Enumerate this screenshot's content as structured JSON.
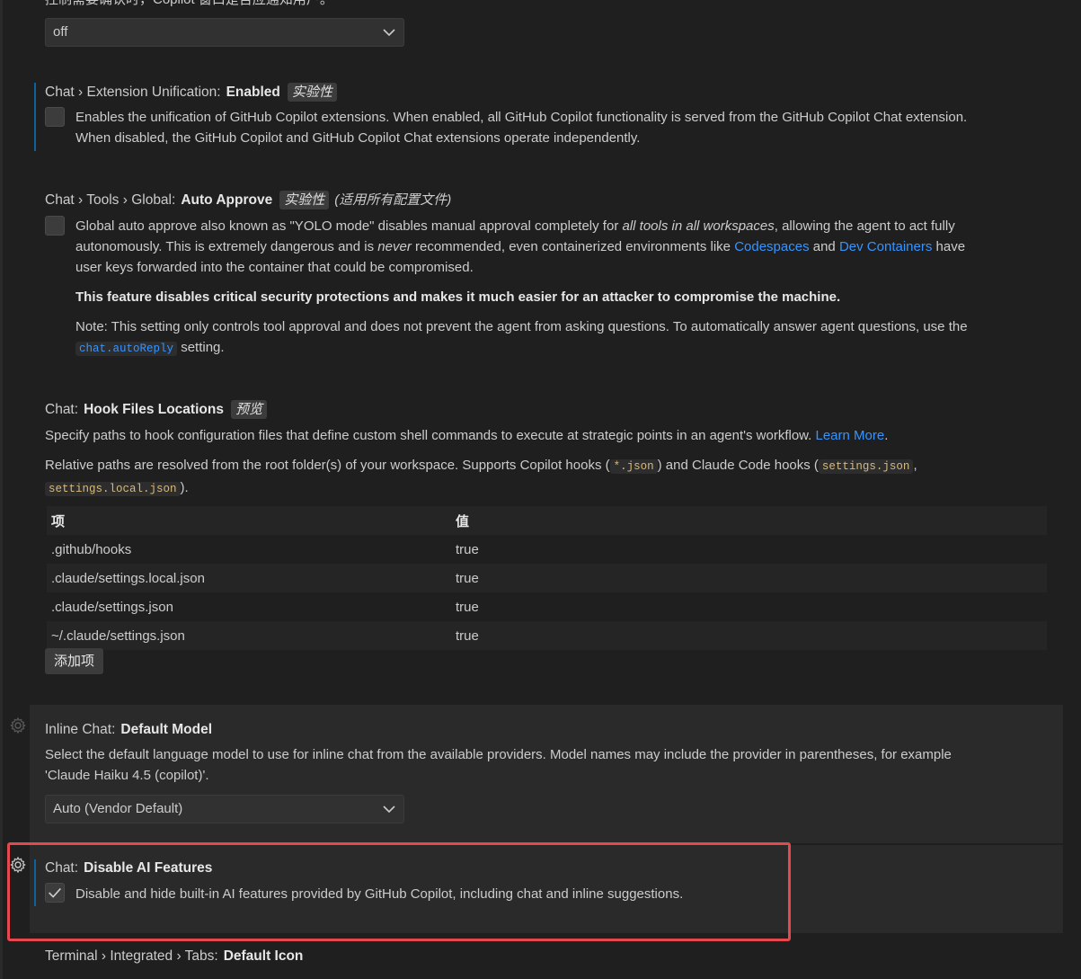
{
  "top_setting": {
    "partial_text": "控制需要确认时，Copilot 窗口是否应通知用户。",
    "select_value": "off"
  },
  "extension_unification": {
    "category": "Chat › Extension Unification:",
    "name": "Enabled",
    "tag": "实验性",
    "description_line1": "Enables the unification of GitHub Copilot extensions. When enabled, all GitHub Copilot functionality is served from the GitHub Copilot Chat extension.",
    "description_line2": "When disabled, the GitHub Copilot and GitHub Copilot Chat extensions operate independently.",
    "checked": false
  },
  "auto_approve": {
    "category": "Chat › Tools › Global:",
    "name": "Auto Approve",
    "tag": "实验性",
    "scope": "(适用所有配置文件)",
    "desc_a": "Global auto approve also known as \"YOLO mode\" disables manual approval completely for ",
    "desc_a_em": "all tools in all workspaces",
    "desc_a2": ", allowing the agent to act fully",
    "desc_b1": "autonomously. This is extremely dangerous and is ",
    "desc_b_em": "never",
    "desc_b2": " recommended, even containerized environments like ",
    "link_codespaces": "Codespaces",
    "desc_b3": " and ",
    "link_dev_containers": "Dev Containers",
    "desc_b4": " have",
    "desc_c": "user keys forwarded into the container that could be compromised.",
    "warn1": "This feature disables ",
    "warn_link": "critical security protections",
    "warn2": " and makes it much easier for an attacker to compromise the machine.",
    "note1": "Note: This setting only controls tool approval and does not prevent the agent from asking questions. To automatically answer agent questions, use the",
    "note_code": "chat.autoReply",
    "note2": " setting.",
    "checked": false
  },
  "hook_files": {
    "category": "Chat:",
    "name": "Hook Files Locations",
    "tag": "预览",
    "desc1": "Specify paths to hook configuration files that define custom shell commands to execute at strategic points in an agent's workflow. ",
    "learn_more": "Learn More",
    "desc1_end": ".",
    "desc2a": "Relative paths are resolved from the root folder(s) of your workspace. Supports Copilot hooks (",
    "code1": "*.json",
    "desc2b": ") and Claude Code hooks (",
    "code2": "settings.json",
    "desc2c": ",",
    "code3": "settings.local.json",
    "desc2d": ").",
    "col_item": "项",
    "col_value": "值",
    "rows": [
      {
        "item": ".github/hooks",
        "value": "true"
      },
      {
        "item": ".claude/settings.local.json",
        "value": "true"
      },
      {
        "item": ".claude/settings.json",
        "value": "true"
      },
      {
        "item": "~/.claude/settings.json",
        "value": "true"
      }
    ],
    "add_button": "添加项"
  },
  "inline_chat_model": {
    "category": "Inline Chat:",
    "name": "Default Model",
    "desc1": "Select the default language model to use for inline chat from the available providers. Model names may include the provider in parentheses, for example",
    "desc2": "'Claude Haiku 4.5 (copilot)'.",
    "select_value": "Auto (Vendor Default)"
  },
  "disable_ai": {
    "category": "Chat:",
    "name": "Disable AI Features",
    "description": "Disable and hide built-in AI features provided by GitHub Copilot, including chat and inline suggestions.",
    "checked": true
  },
  "terminal_tabs": {
    "category": "Terminal › Integrated › Tabs:",
    "name": "Default Icon"
  },
  "colors": {
    "background": "#1f1f1f",
    "focused_row": "#2a2a2a",
    "link": "#3794ff",
    "highlight": "#e5484d"
  }
}
